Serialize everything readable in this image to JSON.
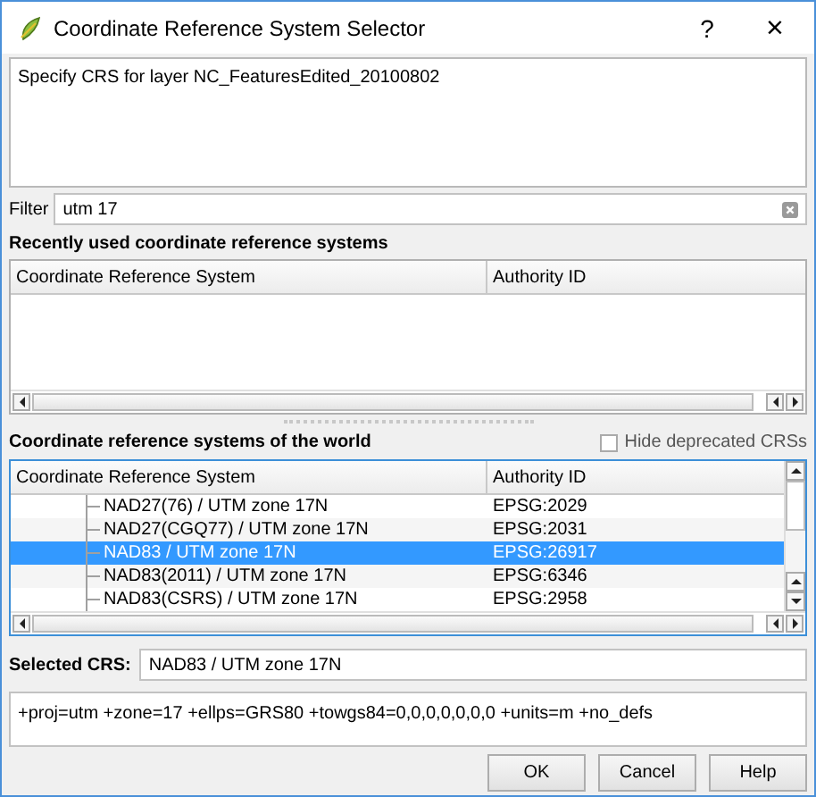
{
  "window": {
    "title": "Coordinate Reference System Selector",
    "help": "?",
    "close": "×"
  },
  "description": "Specify CRS for layer NC_FeaturesEdited_20100802",
  "filter": {
    "label": "Filter",
    "value": "utm 17"
  },
  "recent": {
    "title": "Recently used coordinate reference systems",
    "columns": [
      "Coordinate Reference System",
      "Authority ID"
    ]
  },
  "world": {
    "title": "Coordinate reference systems of the world",
    "hide_deprecated": {
      "label": "Hide deprecated CRSs",
      "checked": false
    },
    "columns": [
      "Coordinate Reference System",
      "Authority ID"
    ],
    "rows": [
      {
        "name": "NAD27(76) / UTM zone 17N",
        "authority": "EPSG:2029",
        "selected": false
      },
      {
        "name": "NAD27(CGQ77) / UTM zone 17N",
        "authority": "EPSG:2031",
        "selected": false
      },
      {
        "name": "NAD83 / UTM zone 17N",
        "authority": "EPSG:26917",
        "selected": true
      },
      {
        "name": "NAD83(2011) / UTM zone 17N",
        "authority": "EPSG:6346",
        "selected": false
      },
      {
        "name": "NAD83(CSRS) / UTM zone 17N",
        "authority": "EPSG:2958",
        "selected": false
      }
    ]
  },
  "selected_crs": {
    "label": "Selected CRS:",
    "value": "NAD83 / UTM zone 17N"
  },
  "proj_string": "+proj=utm +zone=17 +ellps=GRS80 +towgs84=0,0,0,0,0,0,0 +units=m +no_defs",
  "buttons": [
    "OK",
    "Cancel",
    "Help"
  ]
}
